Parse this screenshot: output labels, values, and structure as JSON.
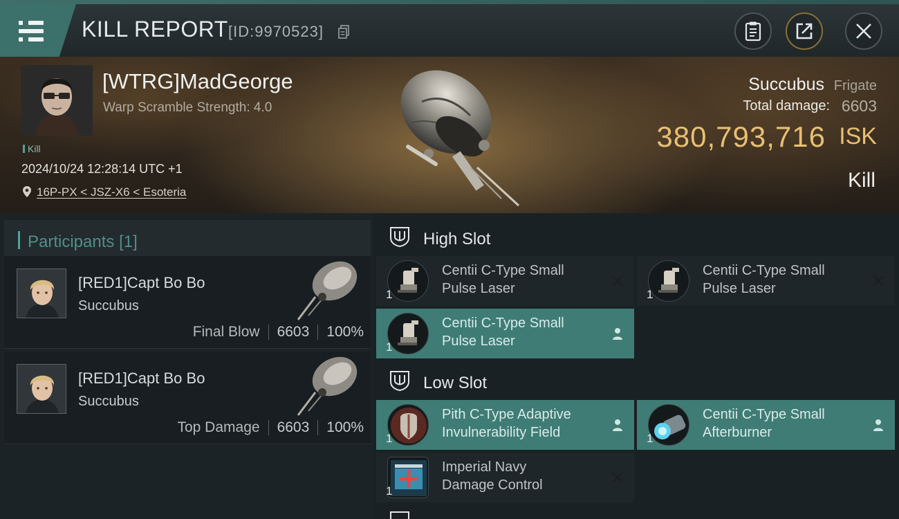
{
  "header": {
    "title": "KILL REPORT",
    "report_id": "[ID:9970523]"
  },
  "hero": {
    "pilot_name": "[WTRG]MadGeorge",
    "pilot_stat": "Warp Scramble Strength: 4.0",
    "kill_tag": "Kill",
    "datetime": "2024/10/24 12:28:14 UTC +1",
    "location": "16P-PX < JSZ-X6 < Esoteria",
    "ship_name": "Succubus",
    "ship_class": "Frigate",
    "total_damage_label": "Total damage:",
    "total_damage": "6603",
    "isk_value": "380,793,716",
    "isk_unit": "ISK",
    "result": "Kill"
  },
  "participants": {
    "title": "Participants",
    "count": "[1]",
    "rows": [
      {
        "name": "[RED1]Capt Bo Bo",
        "ship": "Succubus",
        "role": "Final Blow",
        "damage": "6603",
        "percent": "100%"
      },
      {
        "name": "[RED1]Capt Bo Bo",
        "ship": "Succubus",
        "role": "Top Damage",
        "damage": "6603",
        "percent": "100%"
      }
    ]
  },
  "slots": {
    "high": {
      "title": "High Slot",
      "modules": [
        {
          "name_line1": "Centii C-Type Small",
          "name_line2": "Pulse Laser",
          "qty": "1",
          "status": "destroyed"
        },
        {
          "name_line1": "Centii C-Type Small",
          "name_line2": "Pulse Laser",
          "qty": "1",
          "status": "destroyed"
        },
        {
          "name_line1": "Centii C-Type Small",
          "name_line2": "Pulse Laser",
          "qty": "1",
          "status": "dropped"
        }
      ]
    },
    "low": {
      "title": "Low Slot",
      "modules": [
        {
          "name_line1": "Pith C-Type Adaptive",
          "name_line2": "Invulnerability Field",
          "qty": "1",
          "status": "dropped"
        },
        {
          "name_line1": "Centii C-Type Small",
          "name_line2": "Afterburner",
          "qty": "1",
          "status": "dropped"
        },
        {
          "name_line1": "Imperial Navy",
          "name_line2": "Damage Control",
          "qty": "1",
          "status": "destroyed"
        }
      ]
    }
  },
  "colors": {
    "accent": "#3f7c76",
    "isk": "#e8bf73",
    "panel": "#1f2629"
  }
}
